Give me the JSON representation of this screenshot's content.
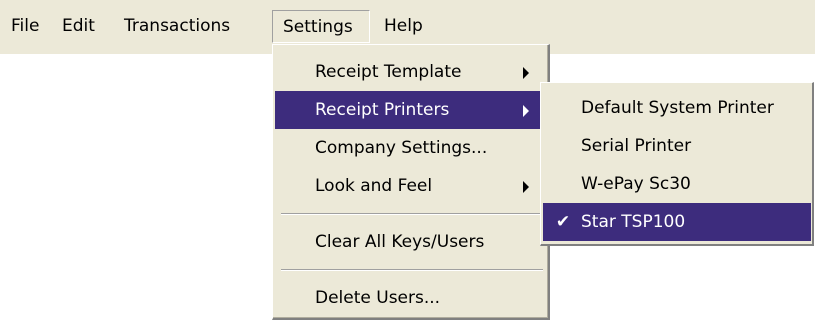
{
  "menubar": {
    "items": [
      "File",
      "Edit",
      "Transactions",
      "Settings",
      "Help"
    ],
    "open_item": "Settings"
  },
  "settings_menu": {
    "items": [
      {
        "label": "Receipt Template",
        "has_submenu": true,
        "highlighted": false
      },
      {
        "label": "Receipt Printers",
        "has_submenu": true,
        "highlighted": true
      },
      {
        "label": "Company Settings...",
        "has_submenu": false,
        "highlighted": false
      },
      {
        "label": "Look and Feel",
        "has_submenu": true,
        "highlighted": false
      },
      {
        "label": "Clear All Keys/Users",
        "has_submenu": false,
        "highlighted": false
      },
      {
        "label": "Delete Users...",
        "has_submenu": false,
        "highlighted": false
      }
    ]
  },
  "printers_submenu": {
    "items": [
      {
        "label": "Default System Printer",
        "checked": false,
        "highlighted": false
      },
      {
        "label": "Serial Printer",
        "checked": false,
        "highlighted": false
      },
      {
        "label": "W-ePay Sc30",
        "checked": false,
        "highlighted": false
      },
      {
        "label": "Star TSP100",
        "checked": true,
        "highlighted": true
      }
    ],
    "check_glyph": "✔"
  },
  "colors": {
    "menu_background": "#ece9d8",
    "highlight": "#3d2c7d"
  }
}
